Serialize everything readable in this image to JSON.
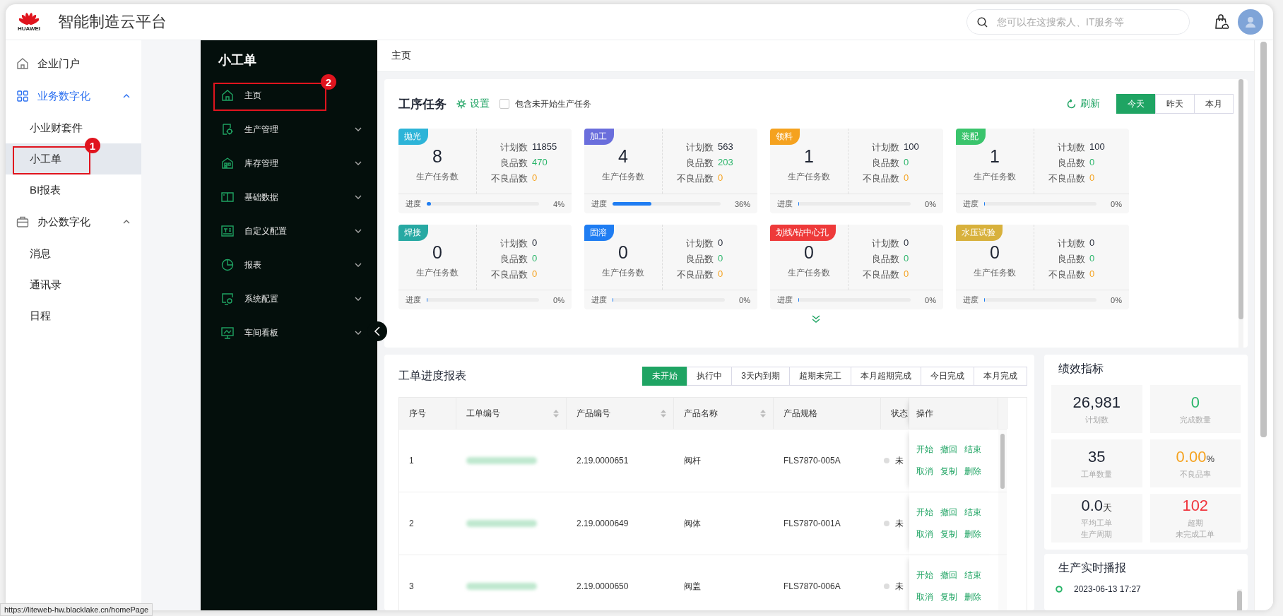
{
  "header": {
    "brand": "HUAWEI",
    "title": "智能制造云平台",
    "search": {
      "placeholder": "您可以在这搜索人、IT服务等"
    }
  },
  "sidebar": {
    "items": [
      {
        "label": "企业门户",
        "selected": false
      },
      {
        "label": "业务数字化",
        "selected": true,
        "expanded": true,
        "children": [
          {
            "label": "小业财套件",
            "selected": false
          },
          {
            "label": "小工单",
            "selected": true,
            "callout": "1"
          },
          {
            "label": "BI报表",
            "selected": false
          }
        ]
      },
      {
        "label": "办公数字化",
        "selected": false,
        "expanded": true,
        "children": [
          {
            "label": "消息",
            "selected": false
          },
          {
            "label": "通讯录",
            "selected": false
          },
          {
            "label": "日程",
            "selected": false
          }
        ]
      }
    ]
  },
  "app_nav": {
    "title": "小工单",
    "items": [
      {
        "label": "主页",
        "callout": "2"
      },
      {
        "label": "生产管理",
        "expanded": false
      },
      {
        "label": "库存管理",
        "expanded": false
      },
      {
        "label": "基础数据",
        "expanded": false
      },
      {
        "label": "自定义配置",
        "expanded": false
      },
      {
        "label": "报表",
        "expanded": false
      },
      {
        "label": "系统配置",
        "expanded": false
      },
      {
        "label": "车间看板",
        "expanded": false
      }
    ]
  },
  "breadcrumb": "主页",
  "tasks": {
    "title": "工序任务",
    "settings": "设置",
    "include_unstarted": {
      "label": "包含未开始生产任务",
      "checked": false
    },
    "refresh": "刷新",
    "ranges": [
      {
        "label": "今天",
        "selected": true
      },
      {
        "label": "昨天",
        "selected": false
      },
      {
        "label": "本月",
        "selected": false
      }
    ],
    "cards": [
      {
        "tag": "抛光",
        "color": "#2db4d8",
        "count": "8",
        "count_label": "生产任务数",
        "stats": [
          {
            "kind": "plan",
            "label": "计划数",
            "value": "11855"
          },
          {
            "kind": "good",
            "label": "良品数",
            "value": "470"
          },
          {
            "kind": "bad",
            "label": "不良品数",
            "value": "0"
          }
        ],
        "progress_label": "进度",
        "level": 0.04,
        "percent": "4%"
      },
      {
        "tag": "加工",
        "color": "#6a6edc",
        "count": "4",
        "count_label": "生产任务数",
        "stats": [
          {
            "kind": "plan",
            "label": "计划数",
            "value": "563"
          },
          {
            "kind": "good",
            "label": "良品数",
            "value": "203"
          },
          {
            "kind": "bad",
            "label": "不良品数",
            "value": "0"
          }
        ],
        "progress_label": "进度",
        "level": 0.36,
        "percent": "36%"
      },
      {
        "tag": "领料",
        "color": "#f5a21f",
        "count": "1",
        "count_label": "生产任务数",
        "stats": [
          {
            "kind": "plan",
            "label": "计划数",
            "value": "100"
          },
          {
            "kind": "good",
            "label": "良品数",
            "value": "0"
          },
          {
            "kind": "bad",
            "label": "不良品数",
            "value": "0"
          }
        ],
        "progress_label": "进度",
        "level": 0,
        "percent": "0%"
      },
      {
        "tag": "装配",
        "color": "#3ac46c",
        "count": "1",
        "count_label": "生产任务数",
        "stats": [
          {
            "kind": "plan",
            "label": "计划数",
            "value": "100"
          },
          {
            "kind": "good",
            "label": "良品数",
            "value": "0"
          },
          {
            "kind": "bad",
            "label": "不良品数",
            "value": "0"
          }
        ],
        "progress_label": "进度",
        "level": 0,
        "percent": "0%"
      },
      {
        "tag": "焊接",
        "color": "#27a9a3",
        "count": "0",
        "count_label": "生产任务数",
        "stats": [
          {
            "kind": "plan",
            "label": "计划数",
            "value": "0"
          },
          {
            "kind": "good",
            "label": "良品数",
            "value": "0"
          },
          {
            "kind": "bad",
            "label": "不良品数",
            "value": "0"
          }
        ],
        "progress_label": "进度",
        "level": 0,
        "percent": "0%"
      },
      {
        "tag": "固溶",
        "color": "#1f7df2",
        "count": "0",
        "count_label": "生产任务数",
        "stats": [
          {
            "kind": "plan",
            "label": "计划数",
            "value": "0"
          },
          {
            "kind": "good",
            "label": "良品数",
            "value": "0"
          },
          {
            "kind": "bad",
            "label": "不良品数",
            "value": "0"
          }
        ],
        "progress_label": "进度",
        "level": 0,
        "percent": "0%"
      },
      {
        "tag": "划线/钻中心孔",
        "color": "#ee3a3a",
        "count": "0",
        "count_label": "生产任务数",
        "stats": [
          {
            "kind": "plan",
            "label": "计划数",
            "value": "0"
          },
          {
            "kind": "good",
            "label": "良品数",
            "value": "0"
          },
          {
            "kind": "bad",
            "label": "不良品数",
            "value": "0"
          }
        ],
        "progress_label": "进度",
        "level": 0,
        "percent": "0%"
      },
      {
        "tag": "水压试验",
        "color": "#d8b13c",
        "count": "0",
        "count_label": "生产任务数",
        "stats": [
          {
            "kind": "plan",
            "label": "计划数",
            "value": "0"
          },
          {
            "kind": "good",
            "label": "良品数",
            "value": "0"
          },
          {
            "kind": "bad",
            "label": "不良品数",
            "value": "0"
          }
        ],
        "progress_label": "进度",
        "level": 0,
        "percent": "0%"
      }
    ]
  },
  "work_orders": {
    "title": "工单进度报表",
    "filters": [
      {
        "label": "未开始",
        "selected": true
      },
      {
        "label": "执行中",
        "selected": false
      },
      {
        "label": "3天内到期",
        "selected": false
      },
      {
        "label": "超期未完工",
        "selected": false
      },
      {
        "label": "本月超期完成",
        "selected": false
      },
      {
        "label": "今日完成",
        "selected": false
      },
      {
        "label": "本月完成",
        "selected": false
      }
    ],
    "columns": [
      {
        "label": "序号",
        "sortable": false
      },
      {
        "label": "工单编号",
        "sortable": true
      },
      {
        "label": "产品编号",
        "sortable": true
      },
      {
        "label": "产品名称",
        "sortable": true
      },
      {
        "label": "产品规格",
        "sortable": false
      },
      {
        "label": "状态",
        "sortable": false
      },
      {
        "label": "操作",
        "sortable": false
      }
    ],
    "rows": [
      {
        "index": "1",
        "product_no": "2.19.0000651",
        "product_name": "阀杆",
        "spec": "FLS7870-005A",
        "status": "未",
        "actions": [
          "开始",
          "撤回",
          "结束",
          "取消",
          "复制",
          "删除"
        ]
      },
      {
        "index": "2",
        "product_no": "2.19.0000649",
        "product_name": "阀体",
        "spec": "FLS7870-001A",
        "status": "未",
        "actions": [
          "开始",
          "撤回",
          "结束",
          "取消",
          "复制",
          "删除"
        ]
      },
      {
        "index": "3",
        "product_no": "2.19.0000650",
        "product_name": "阀盖",
        "spec": "FLS7870-006A",
        "status": "未",
        "actions": [
          "开始",
          "撤回",
          "结束",
          "取消",
          "复制",
          "删除"
        ]
      }
    ]
  },
  "metrics": {
    "title": "绩效指标",
    "items": [
      {
        "value": "26,981",
        "label": "计划数",
        "color": "#1f2533"
      },
      {
        "value": "0",
        "label": "完成数量",
        "color": "#2bb56a"
      },
      {
        "value": "35",
        "label": "工单数量",
        "color": "#1f2533"
      },
      {
        "value": "0.00",
        "unit": "%",
        "label": "不良品率",
        "color": "#f5a21f"
      },
      {
        "value": "0.0",
        "unit": "天",
        "label": "平均工单",
        "label_2": "生产周期",
        "color": "#1f2533"
      },
      {
        "value": "102",
        "label": "超期",
        "label_2": "未完成工单",
        "color": "#f0353d"
      }
    ]
  },
  "broadcast": {
    "title": "生产实时播报",
    "entries": [
      {
        "time": "2023-06-13 17:27"
      }
    ]
  },
  "status_url": "https://liteweb-hw.blacklake.cn/homePage"
}
